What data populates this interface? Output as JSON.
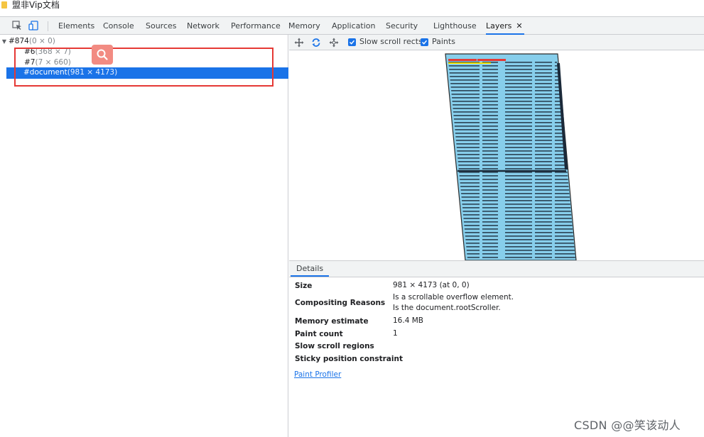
{
  "window": {
    "title": "盟非Vip文档"
  },
  "tabs": [
    {
      "label": "Elements"
    },
    {
      "label": "Console"
    },
    {
      "label": "Sources"
    },
    {
      "label": "Network"
    },
    {
      "label": "Performance"
    },
    {
      "label": "Memory"
    },
    {
      "label": "Application"
    },
    {
      "label": "Security"
    },
    {
      "label": "Lighthouse"
    },
    {
      "label": "Layers",
      "active": true
    }
  ],
  "tab_close": "✕",
  "layer_tree": {
    "root": {
      "name": "#874",
      "size": "(0 × 0)"
    },
    "items": [
      {
        "name": "#6",
        "size": "(368 × 7)"
      },
      {
        "name": "#7",
        "size": "(7 × 660)"
      },
      {
        "name": "#document",
        "size": "(981 × 4173)",
        "selected": true
      }
    ]
  },
  "toolbar": {
    "slow_scroll_rects": {
      "label": "Slow scroll rects",
      "checked": true
    },
    "paints": {
      "label": "Paints",
      "checked": true
    }
  },
  "details": {
    "tab_label": "Details",
    "rows": [
      {
        "label": "Size",
        "value": "981 × 4173 (at 0, 0)"
      },
      {
        "label": "Compositing Reasons",
        "value": "Is a scrollable overflow element.",
        "value2": "Is the document.rootScroller."
      },
      {
        "label": "Memory estimate",
        "value": "16.4 MB"
      },
      {
        "label": "Paint count",
        "value": "1"
      },
      {
        "label": "Slow scroll regions",
        "value": ""
      },
      {
        "label": "Sticky position constraint",
        "value": ""
      }
    ],
    "paint_profiler": "Paint Profiler"
  },
  "watermark": "CSDN @@笑该动人",
  "colors": {
    "accent": "#1a73e8",
    "highlight_box": "#e53935",
    "layer_fill": "#87ceeb"
  }
}
